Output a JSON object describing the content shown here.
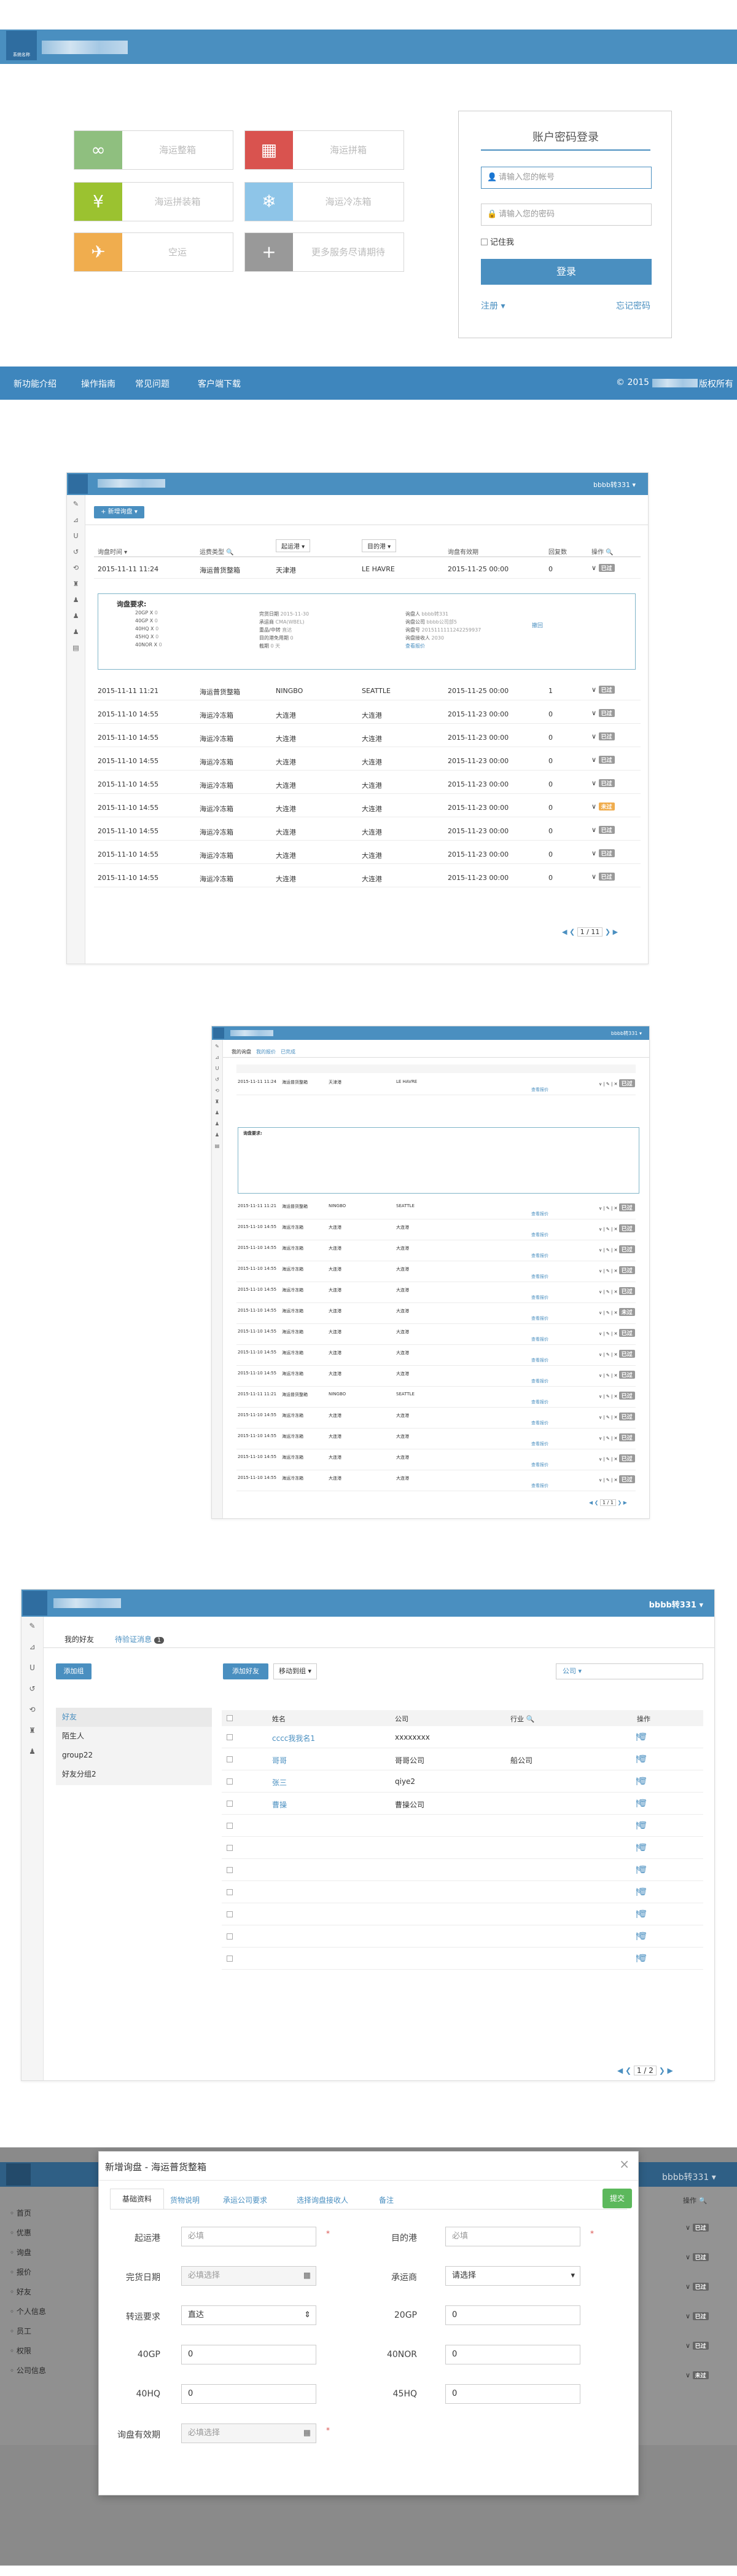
{
  "home": {
    "logo_text": "系统名称",
    "tiles": [
      {
        "label": "海运整箱",
        "icon": "link-icon",
        "color": "#8fbf7f",
        "glyph": "∞"
      },
      {
        "label": "海运拼箱",
        "icon": "grid-icon",
        "color": "#d9534f",
        "glyph": "▦"
      },
      {
        "label": "海运拼装箱",
        "icon": "yen-icon",
        "color": "#9bc230",
        "glyph": "¥"
      },
      {
        "label": "海运冷冻箱",
        "icon": "snow-icon",
        "color": "#8ec5e8",
        "glyph": "❄"
      },
      {
        "label": "空运",
        "icon": "plane-icon",
        "color": "#f0ad4e",
        "glyph": "✈"
      },
      {
        "label": "更多服务尽请期待",
        "icon": "plus-icon",
        "color": "#999999",
        "glyph": "+"
      }
    ],
    "login": {
      "title": "账户密码登录",
      "user_ph": "请输入您的帐号",
      "pass_ph": "请输入您的密码",
      "remember": "记住我",
      "submit": "登录",
      "register": "注册 ▾",
      "forgot": "忘记密码"
    },
    "footer": {
      "links": [
        "新功能介绍",
        "操作指南",
        "常见问题",
        "客户端下载"
      ],
      "copyright": "© 2015",
      "rights": "版权所有"
    }
  },
  "s2": {
    "user": "bbbb转331 ▾",
    "new_btn": "+ 新增询盘 ▾",
    "cols": [
      "询盘时间 ▾",
      "运费类型 🔍",
      "起运港",
      "目的港",
      "询盘有效期",
      "回复数",
      "操作 🔍"
    ],
    "filter1": "起运港 ▾",
    "filter2": "目的港 ▾",
    "first": {
      "time": "2015-11-11 11:24",
      "type": "海运普货整箱",
      "from": "天津港",
      "to": "LE HAVRE",
      "valid": "2015-11-25 00:00",
      "cnt": "0",
      "tag": "已过"
    },
    "detail": {
      "title": "询盘要求:",
      "k1": "20GP X",
      "k2": "40GP X",
      "k3": "40HQ X",
      "k4": "45HQ X",
      "k5": "40NOR X",
      "val": "0",
      "m1": "完货日期",
      "m1v": "2015-11-30",
      "m2": "承运商",
      "m2v": "CMA(WBEL)",
      "m3": "重品/中转",
      "m3v": "直达",
      "m4": "目的港免用期",
      "m4v": "0",
      "m5": "截期",
      "m5v": "0 天",
      "r1": "询盘人",
      "r1v": "bbbb转331",
      "r2": "询盘公司",
      "r2v": "bbbb公司部5",
      "r3": "询盘号",
      "r3v": "2015111111242259937",
      "r4": "询盘接收人",
      "r4v": "2030",
      "r5": "",
      "link": "查看报价",
      "link2": "撤回"
    },
    "rows": [
      {
        "time": "2015-11-11 11:21",
        "type": "海运普货整箱",
        "from": "NINGBO",
        "to": "SEATTLE",
        "valid": "2015-11-25 00:00",
        "cnt": "1",
        "tag": "已过"
      },
      {
        "time": "2015-11-10 14:55",
        "type": "海运冷冻箱",
        "from": "大连港",
        "to": "大连港",
        "valid": "2015-11-23 00:00",
        "cnt": "0",
        "tag": "已过"
      },
      {
        "time": "2015-11-10 14:55",
        "type": "海运冷冻箱",
        "from": "大连港",
        "to": "大连港",
        "valid": "2015-11-23 00:00",
        "cnt": "0",
        "tag": "已过"
      },
      {
        "time": "2015-11-10 14:55",
        "type": "海运冷冻箱",
        "from": "大连港",
        "to": "大连港",
        "valid": "2015-11-23 00:00",
        "cnt": "0",
        "tag": "已过"
      },
      {
        "time": "2015-11-10 14:55",
        "type": "海运冷冻箱",
        "from": "大连港",
        "to": "大连港",
        "valid": "2015-11-23 00:00",
        "cnt": "0",
        "tag": "已过"
      },
      {
        "time": "2015-11-10 14:55",
        "type": "海运冷冻箱",
        "from": "大连港",
        "to": "大连港",
        "valid": "2015-11-23 00:00",
        "cnt": "0",
        "tag": "未过"
      },
      {
        "time": "2015-11-10 14:55",
        "type": "海运冷冻箱",
        "from": "大连港",
        "to": "大连港",
        "valid": "2015-11-23 00:00",
        "cnt": "0",
        "tag": "已过"
      },
      {
        "time": "2015-11-10 14:55",
        "type": "海运冷冻箱",
        "from": "大连港",
        "to": "大连港",
        "valid": "2015-11-23 00:00",
        "cnt": "0",
        "tag": "已过"
      },
      {
        "time": "2015-11-10 14:55",
        "type": "海运冷冻箱",
        "from": "大连港",
        "to": "大连港",
        "valid": "2015-11-23 00:00",
        "cnt": "0",
        "tag": "已过"
      }
    ],
    "pager": "1 / 11"
  },
  "s3": {
    "user": "bbbb转331 ▾",
    "tabs": [
      "我的询盘",
      "我的报价",
      "已完成"
    ],
    "pager": "1 / 1"
  },
  "s4": {
    "user": "bbbb转331 ▾",
    "tabs": [
      "我的好友",
      "待验证消息"
    ],
    "badge": "1",
    "add_btn": "添加组",
    "add_friend": "添加好友",
    "move": "移动到组 ▾",
    "search": "公司 ▾",
    "groups": [
      "好友",
      "陌生人",
      "group22",
      "好友分组2"
    ],
    "cols": [
      "姓名",
      "公司",
      "行业 🔍",
      "操作"
    ],
    "rows": [
      {
        "name": "cccc我我名1",
        "company": "xxxxxxxx",
        "ind": ""
      },
      {
        "name": "哥哥",
        "company": "哥哥公司",
        "ind": "船公司"
      },
      {
        "name": "张三",
        "company": "qiye2",
        "ind": ""
      },
      {
        "name": "曹操",
        "company": "曹操公司",
        "ind": ""
      }
    ],
    "empty_rows": 7,
    "pager": "1 / 2"
  },
  "s5": {
    "user": "bbbb转331 ▾",
    "side": [
      "首页",
      "优惠",
      "询盘",
      "报价",
      "好友",
      "个人信息",
      "员工",
      "权限",
      "公司信息"
    ],
    "col": "操作 🔍",
    "title": "新增询盘 - 海运普货整箱",
    "close": "×",
    "tabs": [
      "基础资料",
      "货物说明",
      "承运公司要求",
      "选择询盘接收人",
      "备注"
    ],
    "submit": "提交",
    "f": {
      "from_l": "起运港",
      "from_p": "必填",
      "to_l": "目的港",
      "to_p": "必填",
      "date_l": "完货日期",
      "date_p": "必填选择",
      "carrier_l": "承运商",
      "carrier_v": "请选择",
      "trans_l": "转运要求",
      "trans_v": "直达",
      "gp20_l": "20GP",
      "gp20_v": "0",
      "gp40_l": "40GP",
      "gp40_v": "0",
      "nor_l": "40NOR",
      "nor_v": "0",
      "hq40_l": "40HQ",
      "hq40_v": "0",
      "hq45_l": "45HQ",
      "hq45_v": "0",
      "valid_l": "询盘有效期",
      "valid_p": "必填选择",
      "star": "*"
    },
    "right_tags": [
      "已过",
      "已过",
      "已过",
      "已过",
      "已过",
      "未过"
    ]
  }
}
